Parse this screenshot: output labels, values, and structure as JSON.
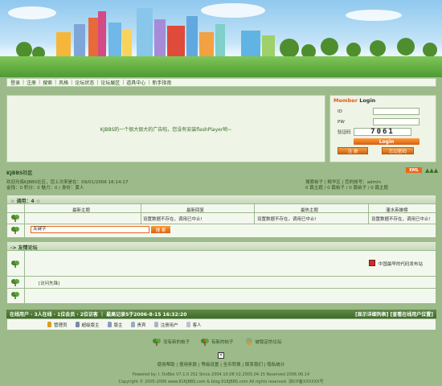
{
  "nav": {
    "items": [
      "登录",
      "注册",
      "搜索",
      "风格",
      "论坛状态",
      "论坛展区",
      "道具中心",
      "新手指南"
    ]
  },
  "ad": {
    "text": "KJBBS的一个很大很大的广告啦，您没有安装flashPlayer哟~"
  },
  "login": {
    "title_member": "Member",
    "title_login": "Login",
    "id_label": "ID",
    "pw_label": "PW",
    "captcha_label": "验证码",
    "captcha_value": "7061",
    "login_button": "Login",
    "register_button": "注 册",
    "forgot_button": "忘记密码"
  },
  "forum": {
    "name": "KJBBS社区",
    "xml_badge": "XML",
    "welcome_line": "欢迎光临KJBBS社区，您上次来是在：09/01/2006 16:14:17",
    "right_links": "搜索帖子 | 精华区 | 您的帐号：admin",
    "stats_left": "金钱：0 积分：0 魅力：0 / 身份：黄人",
    "stats_right": "0 篇主题 / 0 篇帖子 / 0 篇帖子 / 0 篇主题"
  },
  "hot": {
    "head": "调用：4",
    "col_titles": [
      "最新主题",
      "最新回复",
      "最热主题",
      "灌水英雄榜"
    ],
    "cells": [
      "设置数据不存在，调用已中止!",
      "设置数据不存在，调用已中止!",
      "设置数据不存在，调用已中止!",
      "设置数据不存在，调用已中止!"
    ],
    "search_value": "关键字",
    "search_button": "搜 索"
  },
  "friends": {
    "head": "-> 友情论坛",
    "logo_text": "中国最早的代码发布站",
    "link_text": "[访问先锋]"
  },
  "online": {
    "left": "在线用户 · 3人在线 · 1位会员 · 2位访客 ｜ 最高记录5于2006-8-15 16:32:20",
    "right": "[显示详细列表] [查看在线用户位置]",
    "legend": [
      "管理员",
      "超级版主",
      "版主",
      "贵宾",
      "注册用户",
      "客人"
    ]
  },
  "icons": [
    "没有新的帖子",
    "有新的帖子",
    "被锁定的论坛"
  ],
  "footer": {
    "links": "使用帮助 | 使用条款 | 等级设置 | 全币转换 | 联系我们 | 隐私统计",
    "line1": "Powered by: I. DvBbs V7.1.0 2S1 Since 2004.10.08 V2.2005.04.15 Reserved 2006.06.14",
    "line2": "Copyright © 2005-2006 www.91KJBBS.com & blog.91KJBBS.com All rights reserved. 浙ICP备XXXXXX号"
  },
  "colors": {
    "background": "#9dba8a",
    "panel": "#f3f8ee",
    "accent_orange": "#e6681c",
    "dark_green": "#3f6a2a"
  }
}
